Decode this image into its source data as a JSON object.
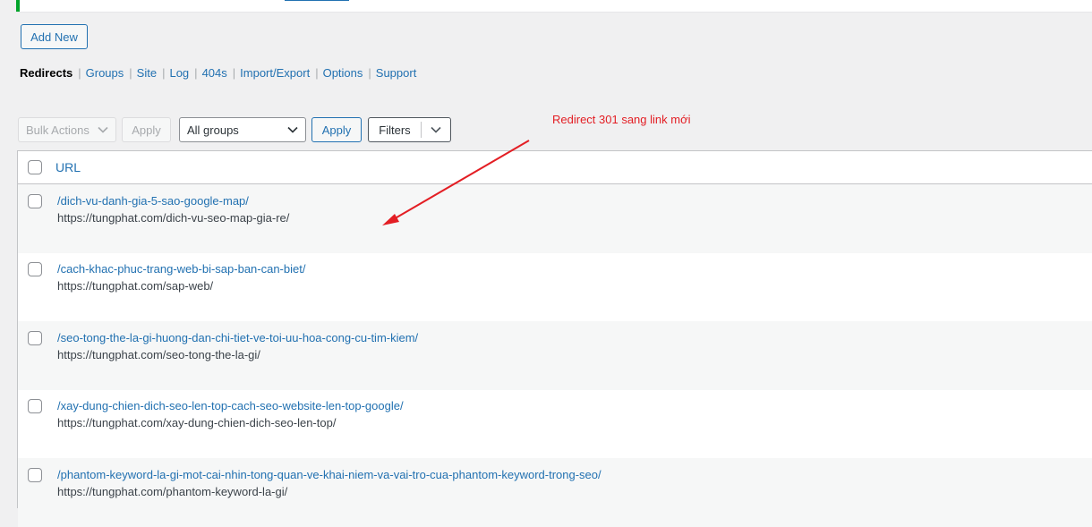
{
  "toolbar": {
    "add_new_label": "Add New",
    "bulk_actions_label": "Bulk Actions",
    "apply_label": "Apply",
    "group_select_value": "All groups",
    "apply2_label": "Apply",
    "filters_label": "Filters"
  },
  "nav": {
    "items": [
      {
        "label": "Redirects",
        "current": true
      },
      {
        "label": "Groups"
      },
      {
        "label": "Site"
      },
      {
        "label": "Log"
      },
      {
        "label": "404s"
      },
      {
        "label": "Import/Export"
      },
      {
        "label": "Options"
      },
      {
        "label": "Support"
      }
    ]
  },
  "table": {
    "header_url": "URL",
    "rows": [
      {
        "source": "/dich-vu-danh-gia-5-sao-google-map/",
        "target": "https://tungphat.com/dich-vu-seo-map-gia-re/"
      },
      {
        "source": "/cach-khac-phuc-trang-web-bi-sap-ban-can-biet/",
        "target": "https://tungphat.com/sap-web/"
      },
      {
        "source": "/seo-tong-the-la-gi-huong-dan-chi-tiet-ve-toi-uu-hoa-cong-cu-tim-kiem/",
        "target": "https://tungphat.com/seo-tong-the-la-gi/"
      },
      {
        "source": "/xay-dung-chien-dich-seo-len-top-cach-seo-website-len-top-google/",
        "target": "https://tungphat.com/xay-dung-chien-dich-seo-len-top/"
      },
      {
        "source": "/phantom-keyword-la-gi-mot-cai-nhin-tong-quan-ve-khai-niem-va-vai-tro-cua-phantom-keyword-trong-seo/",
        "target": "https://tungphat.com/phantom-keyword-la-gi/"
      }
    ]
  },
  "annotation": {
    "text": "Redirect 301 sang link mới",
    "color": "#e31e24"
  },
  "colors": {
    "link": "#2271b1",
    "notice_border": "#00a32a",
    "background": "#f0f0f1"
  }
}
